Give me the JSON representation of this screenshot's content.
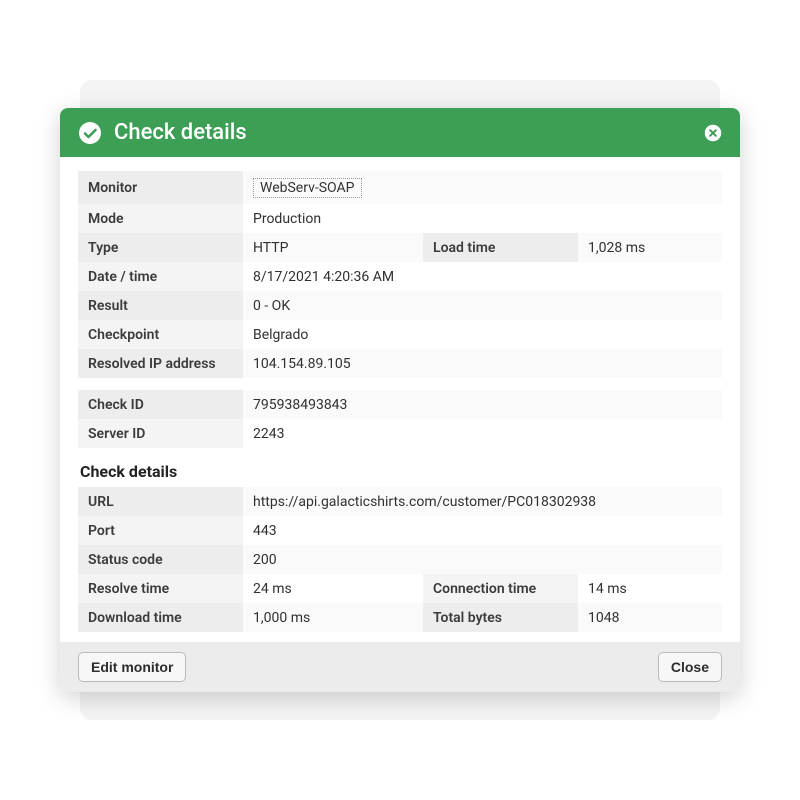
{
  "header": {
    "title": "Check details"
  },
  "labels": {
    "monitor": "Monitor",
    "mode": "Mode",
    "type": "Type",
    "load_time": "Load time",
    "date_time": "Date / time",
    "result": "Result",
    "checkpoint": "Checkpoint",
    "resolved_ip": "Resolved IP address",
    "check_id": "Check ID",
    "server_id": "Server ID",
    "url": "URL",
    "port": "Port",
    "status_code": "Status code",
    "resolve_time": "Resolve time",
    "connection_time": "Connection time",
    "download_time": "Download time",
    "total_bytes": "Total bytes"
  },
  "values": {
    "monitor": "WebServ-SOAP",
    "mode": "Production",
    "type": "HTTP",
    "load_time": "1,028 ms",
    "date_time": "8/17/2021 4:20:36 AM",
    "result": "0 - OK",
    "checkpoint": "Belgrado",
    "resolved_ip": "104.154.89.105",
    "check_id": "795938493843",
    "server_id": "2243",
    "url": "https://api.galacticshirts.com/customer/PC018302938",
    "port": "443",
    "status_code": "200",
    "resolve_time": "24 ms",
    "connection_time": "14 ms",
    "download_time": "1,000 ms",
    "total_bytes": "1048"
  },
  "section": {
    "check_details": "Check details"
  },
  "footer": {
    "edit_monitor": "Edit monitor",
    "close": "Close"
  }
}
